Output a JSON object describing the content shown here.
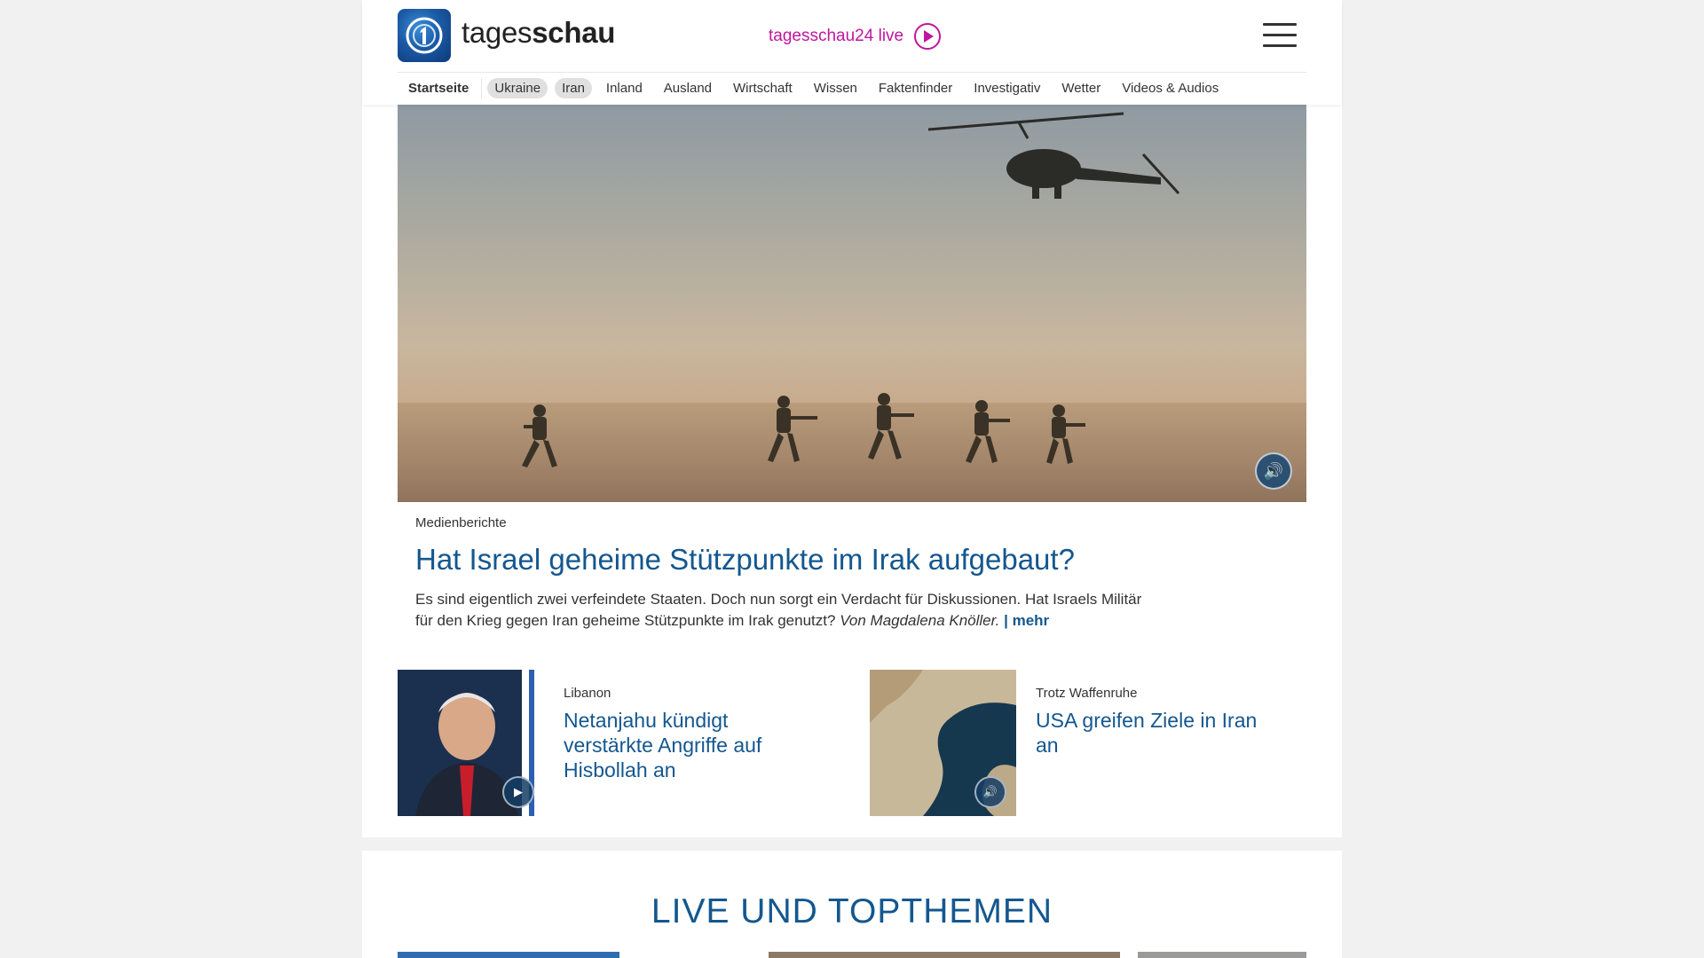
{
  "header": {
    "logo_text_light": "tages",
    "logo_text_bold": "schau",
    "live_label": "tagesschau24 live"
  },
  "nav": {
    "items": [
      "Startseite",
      "Ukraine",
      "Iran",
      "Inland",
      "Ausland",
      "Wirtschaft",
      "Wissen",
      "Faktenfinder",
      "Investigativ",
      "Wetter",
      "Videos & Audios"
    ]
  },
  "hero": {
    "topline": "Medienberichte",
    "headline": "Hat Israel geheime Stützpunkte im Irak aufgebaut?",
    "shorttext": "Es sind eigentlich zwei verfeindete Staaten. Doch nun sorgt ein Verdacht für Diskussionen. Hat Israels Militär für den Krieg gegen Iran geheime Stützpunkte im Irak genutzt?",
    "author": "Von Magdalena Knöller.",
    "more_label": "| mehr"
  },
  "teasers": [
    {
      "topline": "Libanon",
      "headline": "Netanjahu kündigt verstärkte Angriffe auf Hisbollah an",
      "media": "video"
    },
    {
      "topline": "Trotz Waffenruhe",
      "headline": "USA greifen Ziele in Iran an",
      "media": "audio"
    }
  ],
  "section": {
    "title": "LIVE UND TOPTHEMEN"
  },
  "colors": {
    "brand_blue": "#14578f",
    "live_magenta": "#c0169e"
  }
}
